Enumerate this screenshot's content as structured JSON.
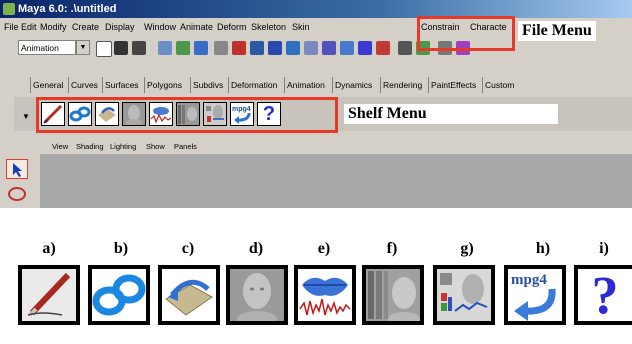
{
  "window": {
    "title": "Maya 6.0: .\\untitled"
  },
  "menubar": {
    "items": [
      "File",
      "Edit",
      "Modify",
      "Create",
      "Display",
      "Window",
      "Animate",
      "Deform",
      "Skeleton",
      "Skin",
      "Constrain",
      "Characte"
    ]
  },
  "toolbar": {
    "menu_set": "Animation"
  },
  "shelf_tabs": [
    "General",
    "Curves",
    "Surfaces",
    "Polygons",
    "Subdivs",
    "Deformation",
    "Animation",
    "Dynamics",
    "Rendering",
    "PaintEffects",
    "Custom"
  ],
  "panel_menu": [
    "View",
    "Shading",
    "Lighting",
    "Show",
    "Panels"
  ],
  "callouts": {
    "file_menu": "File Menu",
    "shelf_menu": "Shelf Menu"
  },
  "icon_labels": [
    "a)",
    "b)",
    "c)",
    "d)",
    "e)",
    "f)",
    "g)",
    "h)",
    "i)"
  ],
  "icon_names": [
    "pencil-icon",
    "mask-loop-icon",
    "cloth-arrow-icon",
    "head-icon",
    "waveform-lips-icon",
    "bars-head-icon",
    "head-graph-icon",
    "mpg4-icon",
    "question-icon"
  ],
  "mpg4_text": "mpg4",
  "question_glyph": "?",
  "colors": {
    "highlight": "#e53a2a",
    "titlebar": "#0a246a",
    "ui_gray": "#d4d0c8"
  }
}
